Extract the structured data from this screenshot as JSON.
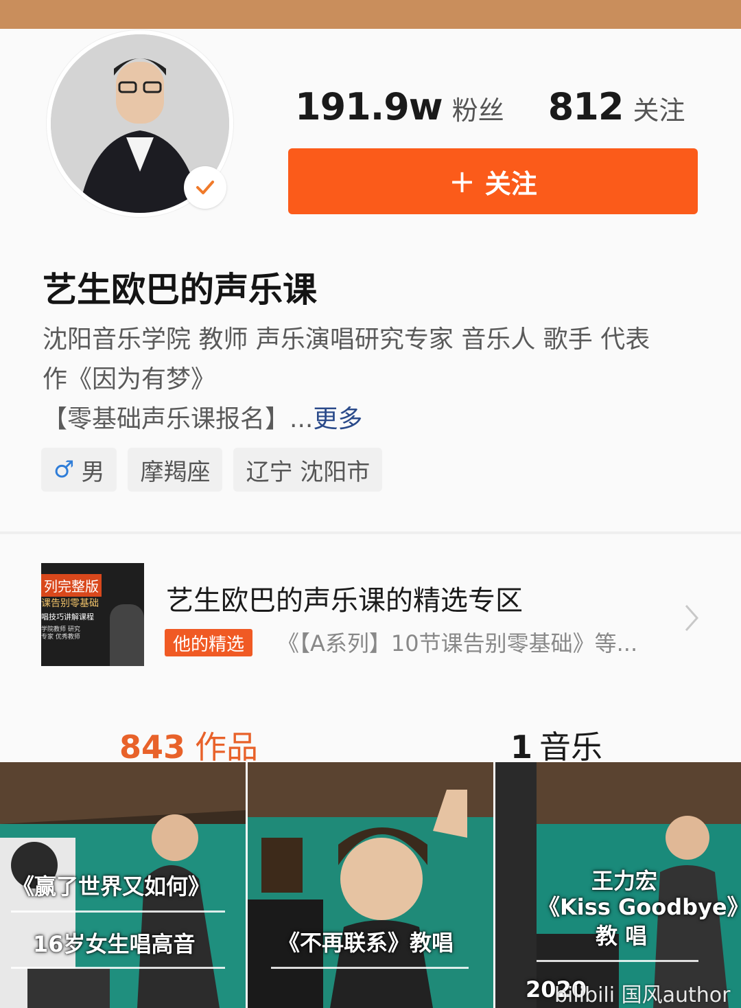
{
  "profile": {
    "followers_count": "191.9w",
    "followers_label": "粉丝",
    "following_count": "812",
    "following_label": "关注",
    "follow_button": "关注",
    "name": "艺生欧巴的声乐课",
    "bio_line1": "沈阳音乐学院 教师  声乐演唱研究专家 音乐人 歌手 代表",
    "bio_line2": "作《因为有梦》",
    "bio_line3": "【零基础声乐课报名】...",
    "bio_more": "更多",
    "tags": [
      "男",
      "摩羯座",
      "辽宁 沈阳市"
    ]
  },
  "featured": {
    "title": "艺生欧巴的声乐课的精选专区",
    "badge": "他的精选",
    "desc": "《【A系列】10节课告别零基础》等...",
    "thumb_text1": "列完整版",
    "thumb_text2": "课告别零基础",
    "thumb_text3": "唱技巧讲解课程",
    "thumb_text4": "学院教师 研究专家 优秀教师"
  },
  "tabs": {
    "works_count": "843",
    "works_label": "作品",
    "music_count": "1",
    "music_label": "音乐"
  },
  "videos": [
    {
      "line1": "《赢了世界又如何》",
      "line2": "16岁女生唱高音"
    },
    {
      "line1": "《不再联系》教唱"
    },
    {
      "line1": "王力宏",
      "line2": "《Kiss Goodbye》",
      "line3": "教  唱",
      "line4": "2020"
    }
  ],
  "watermark": "bilibili 国风author",
  "colors": {
    "accent": "#fb5b1a",
    "works_tab": "#e8622a",
    "link": "#2a4a8a",
    "badge": "#f05a24"
  }
}
